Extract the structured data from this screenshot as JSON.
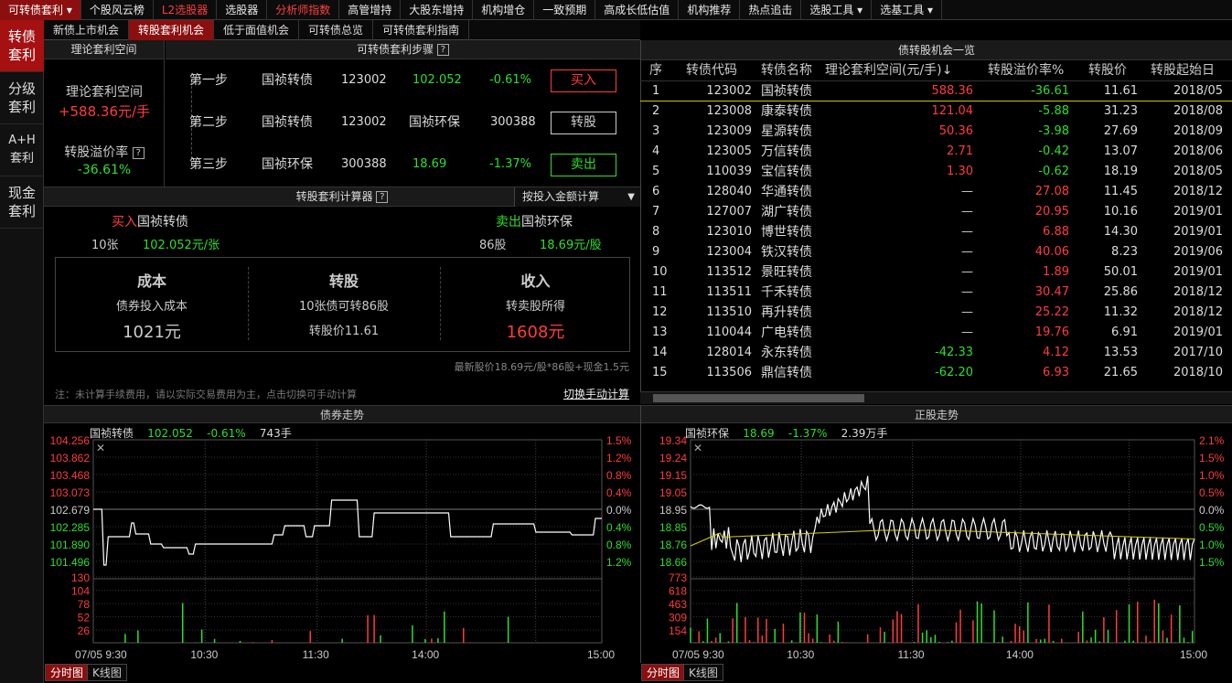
{
  "top_nav": [
    "可转债套利",
    "个股风云榜",
    "L2选股器",
    "选股器",
    "分析师指数",
    "高管增持",
    "大股东增持",
    "机构增仓",
    "一致预期",
    "高成长低估值",
    "机构推荐",
    "热点追击",
    "选股工具",
    "选基工具"
  ],
  "sidebar": [
    "转债\n套利",
    "分级\n套利",
    "A+H\n套利",
    "现金\n套利"
  ],
  "sub_tabs": [
    "新债上市机会",
    "转股套利机会",
    "低于面值机会",
    "可转债总览",
    "可转债套利指南"
  ],
  "arb_space": {
    "header": "理论套利空间",
    "label": "理论套利空间",
    "value": "+588.36元/手",
    "premium_label": "转股溢价率",
    "premium_value": "-36.61%"
  },
  "steps": {
    "header": "可转债套利步骤",
    "rows": [
      {
        "step": "第一步",
        "name": "国祯转债",
        "code": "123002",
        "name2": "",
        "price": "102.052",
        "chg": "-0.61%",
        "action": "买入"
      },
      {
        "step": "第二步",
        "name": "国祯转债",
        "code": "123002",
        "name2": "国祯环保",
        "price": "300388",
        "chg": "",
        "action": "转股"
      },
      {
        "step": "第三步",
        "name": "国祯环保",
        "code": "300388",
        "name2": "",
        "price": "18.69",
        "chg": "-1.37%",
        "action": "卖出"
      }
    ]
  },
  "calc": {
    "header": "转股套利计算器",
    "mode": "按投入金额计算",
    "buy_label": "买入",
    "buy_name": "国祯转债",
    "buy_qty": "10张",
    "buy_price": "102.052元/张",
    "sell_label": "卖出",
    "sell_name": "国祯环保",
    "sell_qty": "86股",
    "sell_price": "18.69元/股",
    "cost_title": "成本",
    "cost_sub": "债券投入成本",
    "cost_val": "1021元",
    "conv_title": "转股",
    "conv_sub": "10张债可转86股",
    "conv_val": "转股价11.61",
    "income_title": "收入",
    "income_sub": "转卖股所得",
    "income_val": "1608元",
    "formula": "最新股价18.69元/股*86股+现金1.5元",
    "note": "注：未计算手续费用，请以实际交易费用为主，点击切换可手动计算",
    "switch": "切换手动计算"
  },
  "table": {
    "header": "债转股机会一览",
    "columns": [
      "序",
      "转债代码",
      "转债名称",
      "理论套利空间(元/手)↓",
      "转股溢价率%",
      "转股价",
      "转股起始日"
    ],
    "rows": [
      [
        "1",
        "123002",
        "国祯转债",
        "588.36",
        "-36.61",
        "11.61",
        "2018/05"
      ],
      [
        "2",
        "123008",
        "康泰转债",
        "121.04",
        "-5.88",
        "31.23",
        "2018/08"
      ],
      [
        "3",
        "123009",
        "星源转债",
        "50.36",
        "-3.98",
        "27.69",
        "2018/09"
      ],
      [
        "4",
        "123005",
        "万信转债",
        "2.71",
        "-0.42",
        "13.07",
        "2018/06"
      ],
      [
        "5",
        "110039",
        "宝信转债",
        "1.30",
        "-0.62",
        "18.19",
        "2018/05"
      ],
      [
        "6",
        "128040",
        "华通转债",
        "—",
        "27.08",
        "11.45",
        "2018/12"
      ],
      [
        "7",
        "127007",
        "湖广转债",
        "—",
        "20.95",
        "10.16",
        "2019/01"
      ],
      [
        "8",
        "123010",
        "博世转债",
        "—",
        "6.88",
        "14.30",
        "2019/01"
      ],
      [
        "9",
        "123004",
        "铁汉转债",
        "—",
        "40.06",
        "8.23",
        "2019/06"
      ],
      [
        "10",
        "113512",
        "景旺转债",
        "—",
        "1.89",
        "50.01",
        "2019/01"
      ],
      [
        "11",
        "113511",
        "千禾转债",
        "—",
        "30.47",
        "25.86",
        "2018/12"
      ],
      [
        "12",
        "113510",
        "再升转债",
        "—",
        "25.22",
        "11.32",
        "2018/12"
      ],
      [
        "13",
        "110044",
        "广电转债",
        "—",
        "19.76",
        "6.91",
        "2019/01"
      ],
      [
        "14",
        "128014",
        "永东转债",
        "-42.33",
        "4.12",
        "13.53",
        "2017/10"
      ],
      [
        "15",
        "113506",
        "鼎信转债",
        "-62.20",
        "6.93",
        "21.65",
        "2018/10"
      ]
    ]
  },
  "bond_chart": {
    "title": "债券走势",
    "name": "国祯转债",
    "price": "102.052",
    "chg": "-0.61%",
    "vol": "743手",
    "yl": [
      "104.256",
      "103.862",
      "103.468",
      "103.073",
      "102.679",
      "102.285",
      "101.890",
      "101.496"
    ],
    "yr": [
      "1.5%",
      "1.2%",
      "0.8%",
      "0.4%",
      "0.0%",
      "0.4%",
      "0.8%",
      "1.2%"
    ],
    "vl": [
      "130",
      "104",
      "78",
      "52",
      "26"
    ],
    "times": [
      "07/05 9:30",
      "10:30",
      "11:30",
      "14:00",
      "15:00"
    ]
  },
  "stock_chart": {
    "title": "正股走势",
    "name": "国祯环保",
    "price": "18.69",
    "chg": "-1.37%",
    "vol": "2.39万手",
    "yl": [
      "19.34",
      "19.24",
      "19.15",
      "19.05",
      "18.95",
      "18.85",
      "18.76",
      "18.66"
    ],
    "yr": [
      "2.1%",
      "1.5%",
      "1.0%",
      "0.5%",
      "0.0%",
      "0.5%",
      "1.0%",
      "1.5%"
    ],
    "vl": [
      "773",
      "618",
      "463",
      "309",
      "154"
    ],
    "times": [
      "07/05 9:30",
      "10:30",
      "11:30",
      "14:00",
      "15:00"
    ]
  },
  "chart_tabs": [
    "分时图",
    "K线图"
  ]
}
